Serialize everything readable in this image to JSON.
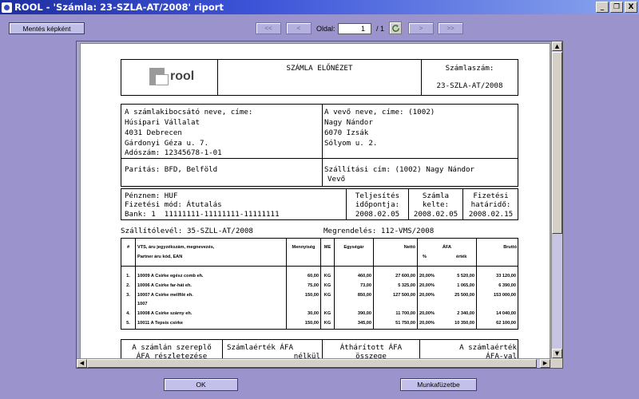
{
  "window": {
    "title": "ROOL  -  'Számla: 23-SZLA-AT/2008' riport",
    "minimize_label": "_",
    "restore_label": "❐",
    "close_label": "X"
  },
  "toolbar": {
    "save_image_label": "Mentés képként",
    "first_label": "<<",
    "prev_label": "<",
    "page_label": "Oldal:",
    "page_value": "1",
    "page_total": "/ 1",
    "next_label": ">",
    "last_label": ">>",
    "refresh_icon": "refresh-icon"
  },
  "invoice": {
    "logo_text": "rool",
    "preview_title": "SZÁMLA ELŐNÉZET",
    "number_label": "Számlaszám:",
    "number_value": "23-SZLA-AT/2008",
    "issuer_label": "A számlakibocsátó neve, címe:",
    "issuer_name": "Húsipari Vállalat",
    "issuer_city": "4031 Debrecen",
    "issuer_street": "Gárdonyi Géza u. 7.",
    "issuer_tax": "Adószám: 12345678-1-01",
    "buyer_label": "A vevő neve, címe: (1002)",
    "buyer_name": "Nagy Nándor",
    "buyer_city": "6070 Izsák",
    "buyer_street": "Sólyom u. 2.",
    "parity": "Paritás: BFD, Belföld",
    "shipping_line1": "Szállítási cím: (1002) Nagy Nándor",
    "shipping_line2": "Vevő",
    "currency": "Pénznem: HUF",
    "payment_method": "Fizetési mód: Átutalás",
    "bank": "Bank: 1  11111111-11111111-11111111",
    "perf_label1": "Teljesítés",
    "perf_label2": "időpontja:",
    "perf_date": "2008.02.05",
    "inv_label1": "Számla",
    "inv_label2": "kelte:",
    "inv_date": "2008.02.05",
    "due_label1": "Fizetési",
    "due_label2": "határidő:",
    "due_date": "2008.02.15",
    "delivery_note": "Szállítólevél: 35-SZLL-AT/2008",
    "order": "Megrendelés: 112-VMS/2008",
    "vat_summary_label1": "A számlán szereplő",
    "vat_summary_label2": "ÁFA részletezése",
    "net_label1": "Számlaérték ÁFA",
    "net_label2": "nélkül",
    "passed_label1": "Áthárított ÁFA",
    "passed_label2": "összege",
    "gross_label1": "A számlaérték",
    "gross_label2": "ÁFA-val"
  },
  "items": {
    "headers": {
      "no": "#",
      "item_line1": "VTS, áru jegyzékszám, megnevezés,",
      "item_line2": "Partner áru kód, EAN",
      "qty": "Mennyiség",
      "unit": "ME",
      "unit_price": "Egységár",
      "net": "Nettó",
      "vat": "ÁFA",
      "vat_pct": "%",
      "vat_value": "érték",
      "gross": "Bruttó"
    },
    "rows": [
      {
        "no": "1.",
        "name": "10009 A Csirke egész comb eh.",
        "qty": "60,00",
        "unit": "KG",
        "price": "460,00",
        "net": "27 600,00",
        "vat_pct": "20,00%",
        "vat_val": "5 520,00",
        "gross": "33 120,00"
      },
      {
        "no": "2.",
        "name": "10006 A Csirke far-hát eh.",
        "qty": "75,00",
        "unit": "KG",
        "price": "73,00",
        "net": "5 325,00",
        "vat_pct": "20,00%",
        "vat_val": "1 065,00",
        "gross": "6 390,00"
      },
      {
        "no": "3.",
        "name": "10007 A Csirke mellfilé eh.",
        "qty": "150,00",
        "unit": "KG",
        "price": "850,00",
        "net": "127 500,00",
        "vat_pct": "20,00%",
        "vat_val": "25 500,00",
        "gross": "153 000,00"
      },
      {
        "no": "",
        "name": "1007",
        "qty": "",
        "unit": "",
        "price": "",
        "net": "",
        "vat_pct": "",
        "vat_val": "",
        "gross": ""
      },
      {
        "no": "4.",
        "name": "10008 A Csirke szárny eh.",
        "qty": "30,00",
        "unit": "KG",
        "price": "390,00",
        "net": "11 700,00",
        "vat_pct": "20,00%",
        "vat_val": "2 340,00",
        "gross": "14 040,00"
      },
      {
        "no": "5.",
        "name": "10011 A Tepsis csirke",
        "qty": "150,00",
        "unit": "KG",
        "price": "345,00",
        "net": "51 750,00",
        "vat_pct": "20,00%",
        "vat_val": "10 350,00",
        "gross": "62 100,00"
      }
    ]
  },
  "footer": {
    "ok_label": "OK",
    "workbook_label": "Munkafüzetbe"
  },
  "colors": {
    "background": "#9b93cc",
    "title_bar": "#1e2fa0",
    "button": "#bfbfe8"
  }
}
